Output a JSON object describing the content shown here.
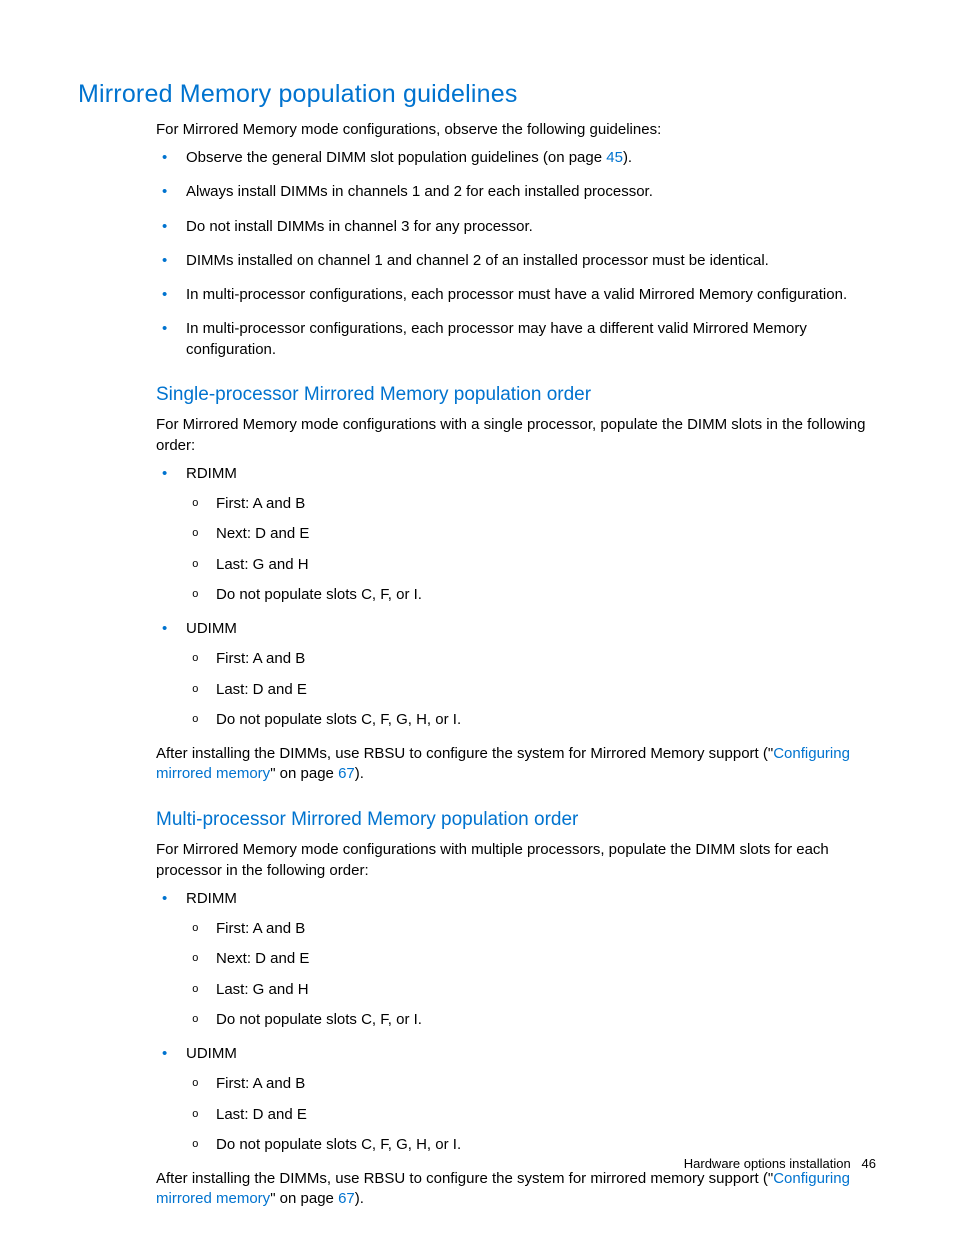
{
  "h1": "Mirrored Memory population guidelines",
  "intro": "For Mirrored Memory mode configurations, observe the following guidelines:",
  "g1_pre": "Observe the general DIMM slot population guidelines (on page ",
  "g1_link": "45",
  "g1_post": ").",
  "g2": "Always install DIMMs in channels 1 and 2 for each installed processor.",
  "g3": "Do not install DIMMs in channel 3 for any processor.",
  "g4": "DIMMs installed on channel 1 and channel 2 of an installed processor must be identical.",
  "g5": "In multi-processor configurations, each processor must have a valid Mirrored Memory configuration.",
  "g6": "In multi-processor configurations, each processor may have a different valid Mirrored Memory configuration.",
  "sp_h": "Single-processor Mirrored Memory population order",
  "sp_intro": "For Mirrored Memory mode configurations with a single processor, populate the DIMM slots in the following order:",
  "sp_rdimm": "RDIMM",
  "sp_r1": "First: A and B",
  "sp_r2": "Next: D and E",
  "sp_r3": "Last: G and H",
  "sp_r4": "Do not populate slots C, F, or I.",
  "sp_udimm": "UDIMM",
  "sp_u1": "First: A and B",
  "sp_u2": "Last: D and E",
  "sp_u3": "Do not populate slots C, F, G, H, or I.",
  "sp_after_pre": "After installing the DIMMs, use RBSU to configure the system for Mirrored Memory support (\"",
  "sp_after_link": "Configuring mirrored memory",
  "sp_after_mid": "\" on page ",
  "sp_after_page": "67",
  "sp_after_post": ").",
  "mp_h": "Multi-processor Mirrored Memory population order",
  "mp_intro": "For Mirrored Memory mode configurations with multiple processors, populate the DIMM slots for each processor in the following order:",
  "mp_rdimm": "RDIMM",
  "mp_r1": "First: A and B",
  "mp_r2": "Next: D and E",
  "mp_r3": "Last: G and H",
  "mp_r4": "Do not populate slots C, F, or I.",
  "mp_udimm": "UDIMM",
  "mp_u1": "First: A and B",
  "mp_u2": "Last: D and E",
  "mp_u3": "Do not populate slots C, F, G, H, or I.",
  "mp_after_pre": "After installing the DIMMs, use RBSU to configure the system for mirrored memory support (\"",
  "mp_after_link": "Configuring mirrored memory",
  "mp_after_mid": "\" on page ",
  "mp_after_page": "67",
  "mp_after_post": ").",
  "footer_text": "Hardware options installation",
  "footer_page": "46"
}
